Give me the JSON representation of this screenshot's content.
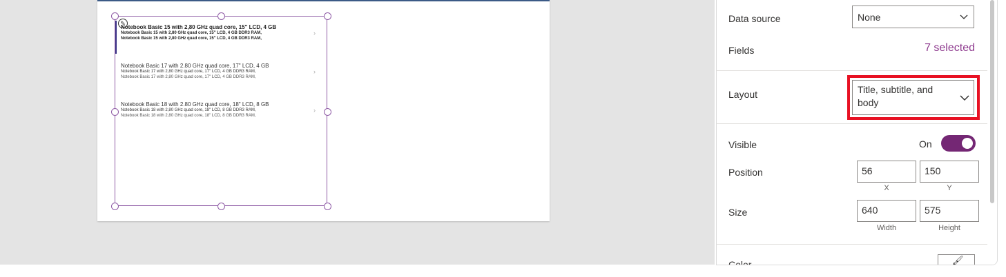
{
  "gallery": {
    "items": [
      {
        "title": "Notebook Basic 15 with 2,80 GHz quad core, 15\" LCD, 4 GB",
        "subtitle": "Notebook Basic 15 with 2,80 GHz quad core, 15\" LCD, 4 GB DDR3 RAM,",
        "body": "Notebook Basic 15 with 2,80 GHz quad core, 15\" LCD, 4 GB DDR3 RAM,"
      },
      {
        "title": "Notebook Basic 17 with 2.80 GHz quad core, 17\" LCD, 4 GB",
        "subtitle": "Notebook Basic 17 with 2,80 GHz quad core, 17\" LCD, 4 GB DDR3 RAM,",
        "body": "Notebook Basic 17 with 2,80 GHz quad core, 17\" LCD, 4 GB DDR3 RAM,"
      },
      {
        "title": "Notebook Basic 18 with 2.80 GHz quad core, 18\" LCD, 8 GB",
        "subtitle": "Notebook Basic 18 with 2,80 GHz quad core, 18\" LCD, 8 GB DDR3 RAM,",
        "body": "Notebook Basic 18 with 2,80 GHz quad core, 18\" LCD, 8 GB DDR3 RAM,"
      }
    ],
    "chevron": "›"
  },
  "panel": {
    "data_source_label": "Data source",
    "data_source_value": "None",
    "fields_label": "Fields",
    "fields_value": "7 selected",
    "layout_label": "Layout",
    "layout_value": "Title, subtitle, and body",
    "visible_label": "Visible",
    "visible_state": "On",
    "position_label": "Position",
    "position_x": "56",
    "position_y": "150",
    "x_caption": "X",
    "y_caption": "Y",
    "size_label": "Size",
    "size_width": "640",
    "size_height": "575",
    "width_caption": "Width",
    "height_caption": "Height",
    "color_label": "Color"
  },
  "colors": {
    "accent": "#742774",
    "highlight_box": "#e81123",
    "fields_text": "#8e3a8e"
  },
  "icons": {
    "chevron_down": "chevron-down-icon",
    "edit": "edit-pencil-icon",
    "paint": "paint-bucket-icon"
  }
}
